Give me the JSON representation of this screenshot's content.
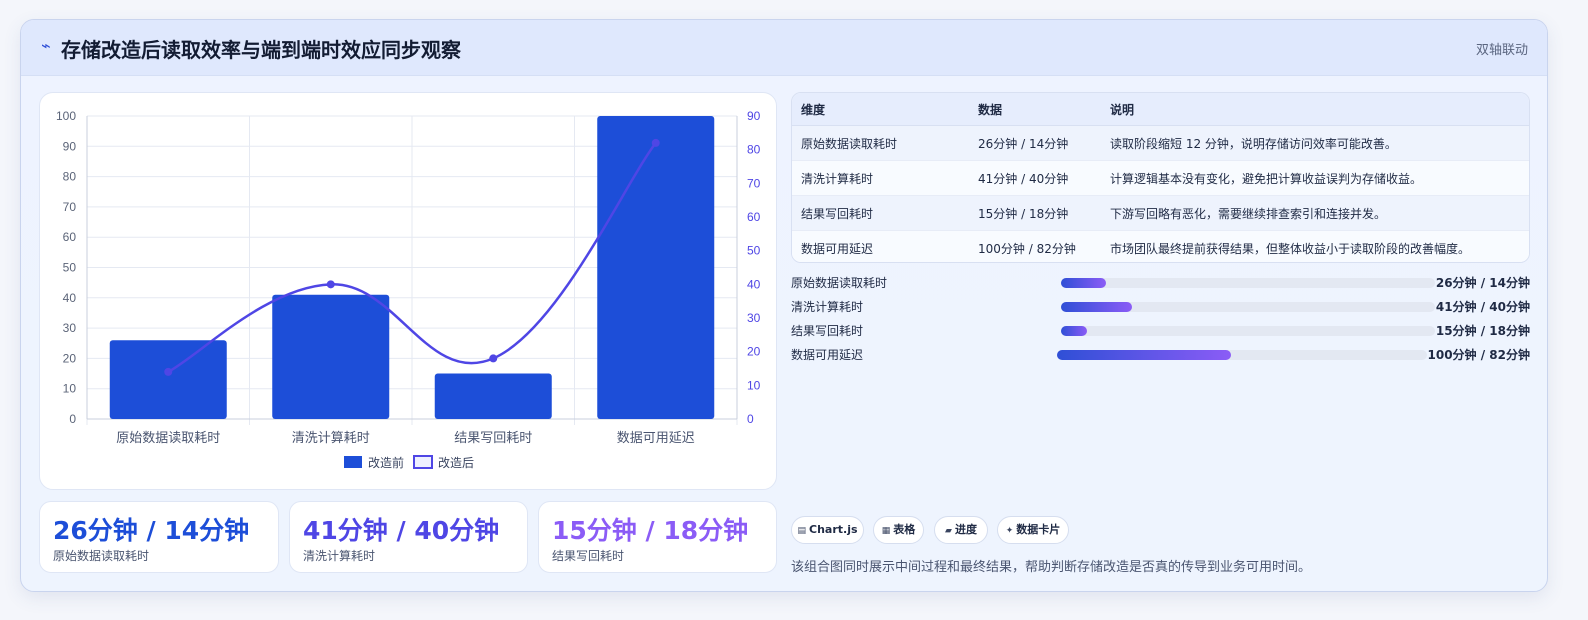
{
  "header": {
    "icon": "lightning-icon",
    "title": "存储改造后读取效率与端到端时效应同步观察",
    "tag": "双轴联动"
  },
  "chart_data": {
    "type": "bar+line",
    "categories": [
      "原始数据读取耗时",
      "清洗计算耗时",
      "结果写回耗时",
      "数据可用延迟"
    ],
    "series": [
      {
        "name": "改造前",
        "type": "bar",
        "axis": "left",
        "values": [
          26,
          41,
          15,
          100
        ],
        "color": "#1d4ed8"
      },
      {
        "name": "改造后",
        "type": "line",
        "axis": "right",
        "values": [
          14,
          40,
          18,
          82
        ],
        "color": "#4f46e5"
      }
    ],
    "y_left": {
      "min": 0,
      "max": 100,
      "ticks": [
        "0",
        "10",
        "20",
        "30",
        "40",
        "50",
        "60",
        "70",
        "80",
        "90",
        "100"
      ]
    },
    "y_right": {
      "min": 0,
      "max": 90,
      "ticks": [
        "0",
        "10",
        "20",
        "30",
        "40",
        "50",
        "60",
        "70",
        "80",
        "90"
      ]
    },
    "legend_position": "bottom",
    "grid": true
  },
  "kpis": [
    {
      "value": "26分钟 / 14分钟",
      "label": "原始数据读取耗时",
      "color": "#1d4ed8"
    },
    {
      "value": "41分钟 / 40分钟",
      "label": "清洗计算耗时",
      "color": "#4f46e5"
    },
    {
      "value": "15分钟 / 18分钟",
      "label": "结果写回耗时",
      "color": "#8b5cf6"
    }
  ],
  "table": {
    "headers": [
      "维度",
      "数据",
      "说明"
    ],
    "rows": [
      [
        "原始数据读取耗时",
        "26分钟 / 14分钟",
        "读取阶段缩短 12 分钟，说明存储访问效率可能改善。"
      ],
      [
        "清洗计算耗时",
        "41分钟 / 40分钟",
        "计算逻辑基本没有变化，避免把计算收益误判为存储收益。"
      ],
      [
        "结果写回耗时",
        "15分钟 / 18分钟",
        "下游写回略有恶化，需要继续排查索引和连接并发。"
      ],
      [
        "数据可用延迟",
        "100分钟 / 82分钟",
        "市场团队最终提前获得结果，但整体收益小于读取阶段的改善幅度。"
      ]
    ]
  },
  "progress": [
    {
      "label": "原始数据读取耗时",
      "value": "26分钟 / 14分钟",
      "fraction": 0.12
    },
    {
      "label": "清洗计算耗时",
      "value": "41分钟 / 40分钟",
      "fraction": 0.19
    },
    {
      "label": "结果写回耗时",
      "value": "15分钟 / 18分钟",
      "fraction": 0.07
    },
    {
      "label": "数据可用延迟",
      "value": "100分钟 / 82分钟",
      "fraction": 0.47
    }
  ],
  "chips": [
    {
      "icon": "chart-icon",
      "glyph": "▤",
      "label": "Chart.js"
    },
    {
      "icon": "table-icon",
      "glyph": "▦",
      "label": "表格"
    },
    {
      "icon": "progress-icon",
      "glyph": "▰",
      "label": "进度"
    },
    {
      "icon": "sparkle-icon",
      "glyph": "✦",
      "label": "数据卡片"
    }
  ],
  "footnote": "该组合图同时展示中间过程和最终结果，帮助判断存储改造是否真的传导到业务可用时间。"
}
